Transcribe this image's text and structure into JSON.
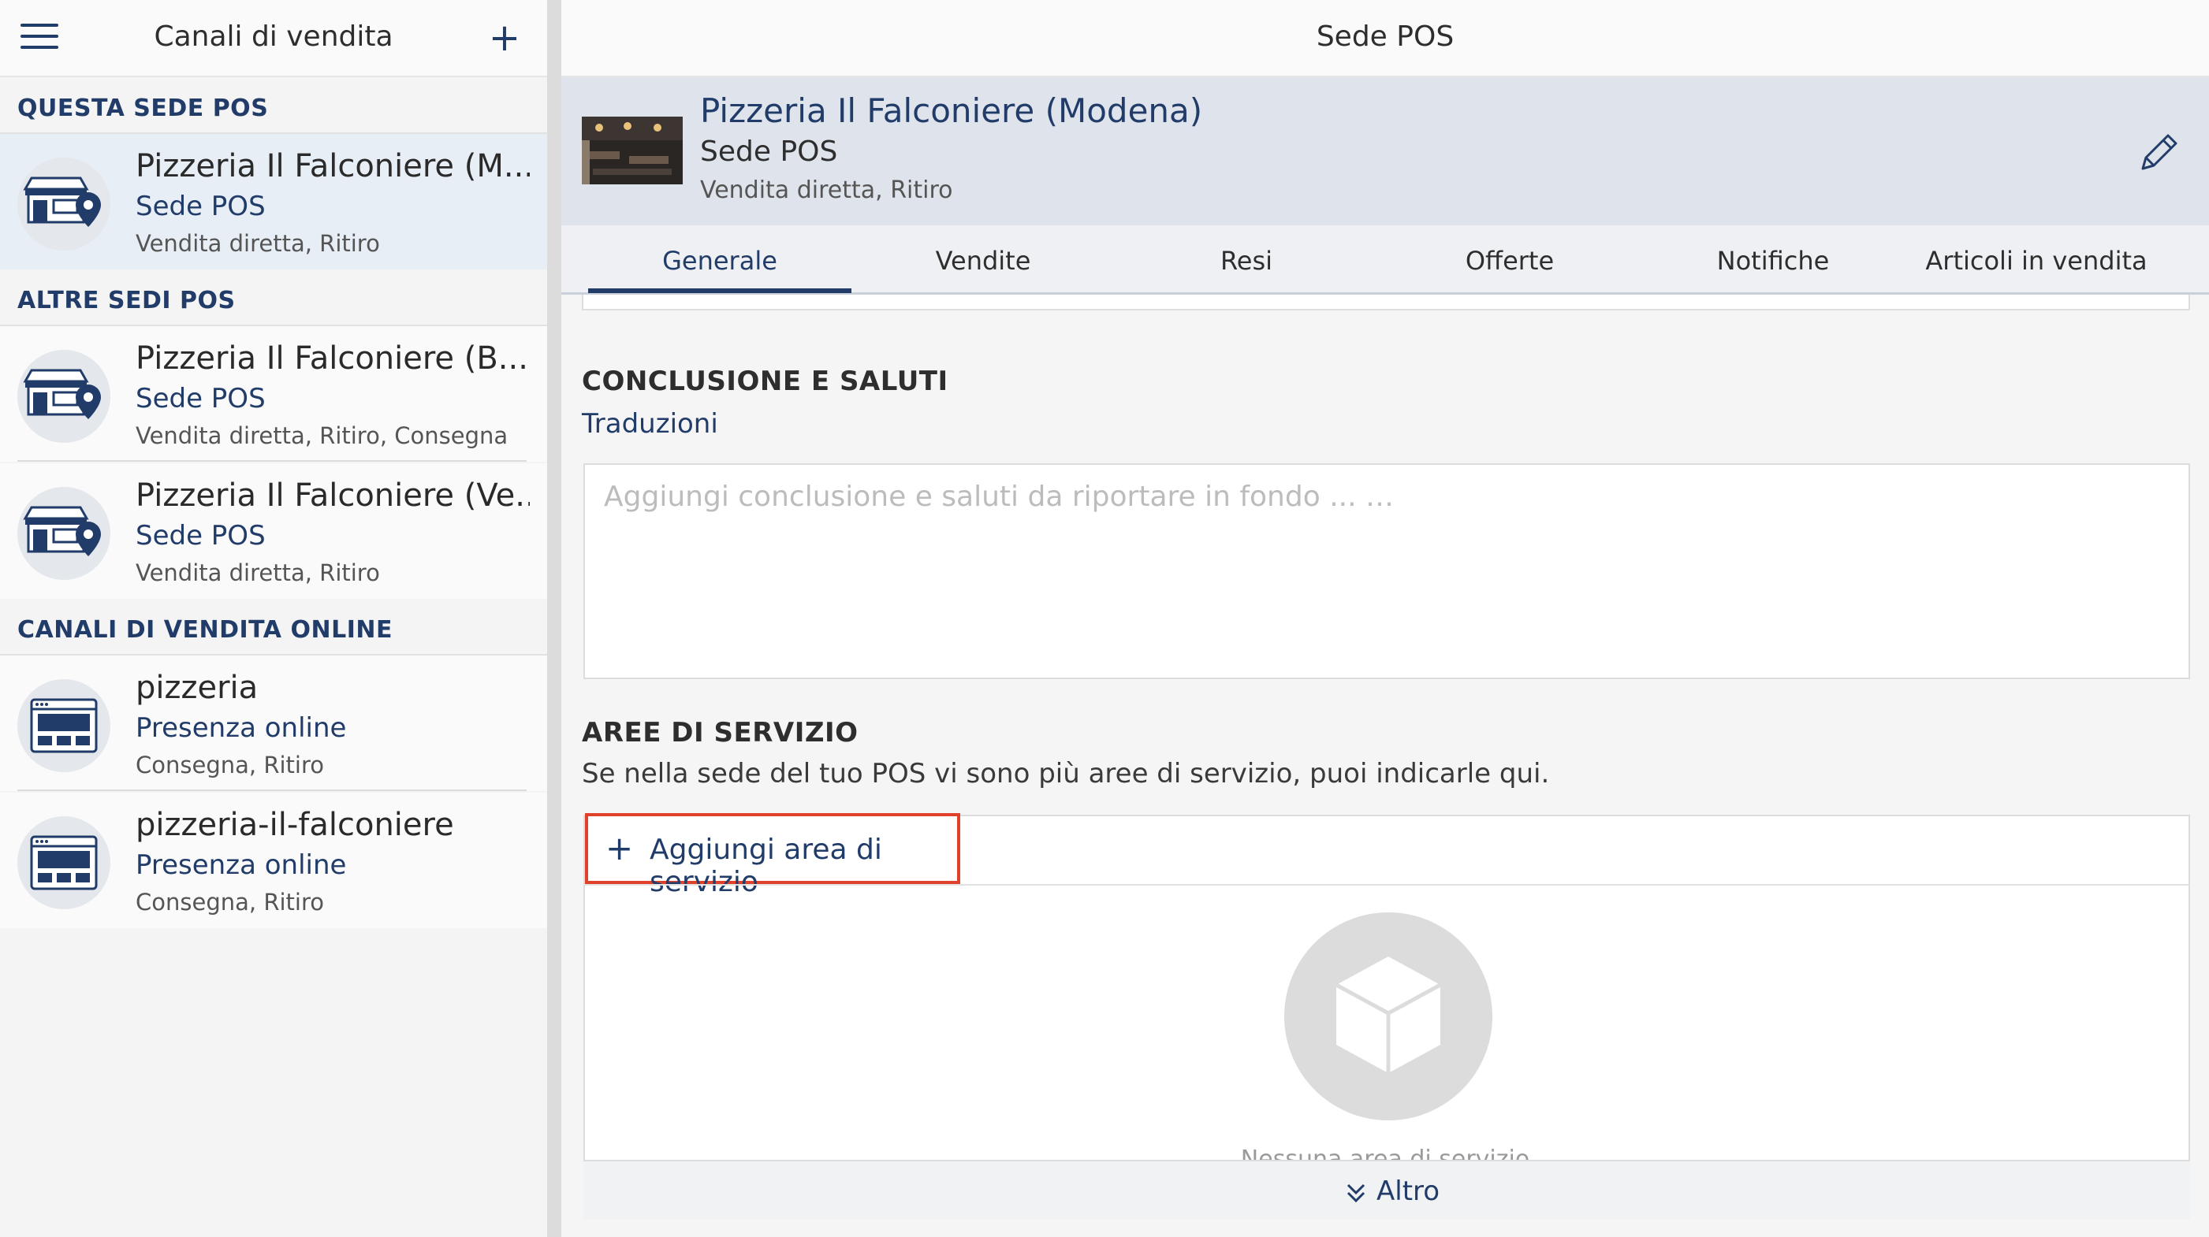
{
  "left": {
    "title": "Canali di vendita",
    "add_label": "+",
    "sections": [
      {
        "title": "QUESTA SEDE POS"
      },
      {
        "title": "ALTRE SEDI POS"
      },
      {
        "title": "CANALI DI VENDITA ONLINE"
      }
    ],
    "items": [
      {
        "name": "Pizzeria Il Falconiere (M...",
        "type": "Sede POS",
        "sub": "Vendita diretta, Ritiro",
        "icon": "store-location-icon"
      },
      {
        "name": "Pizzeria Il Falconiere (B...",
        "type": "Sede POS",
        "sub": "Vendita diretta, Ritiro, Consegna",
        "icon": "store-location-icon"
      },
      {
        "name": "Pizzeria Il Falconiere (Ve...",
        "type": "Sede POS",
        "sub": "Vendita diretta, Ritiro",
        "icon": "store-location-icon"
      },
      {
        "name": "pizzeria",
        "type": "Presenza online",
        "sub": "Consegna, Ritiro",
        "icon": "browser-window-icon"
      },
      {
        "name": "pizzeria-il-falconiere",
        "type": "Presenza online",
        "sub": "Consegna, Ritiro",
        "icon": "browser-window-icon"
      }
    ]
  },
  "right": {
    "title": "Sede POS",
    "info": {
      "name": "Pizzeria Il Falconiere (Modena)",
      "type": "Sede POS",
      "sub": "Vendita diretta, Ritiro"
    },
    "tabs": [
      {
        "label": "Generale"
      },
      {
        "label": "Vendite"
      },
      {
        "label": "Resi"
      },
      {
        "label": "Offerte"
      },
      {
        "label": "Notifiche"
      },
      {
        "label": "Articoli in vendita"
      }
    ],
    "closing": {
      "title": "CONCLUSIONE E SALUTI",
      "translations": "Traduzioni",
      "placeholder": "Aggiungi conclusione e saluti da riportare in fondo ... …"
    },
    "areas": {
      "title": "AREE DI SERVIZIO",
      "desc": "Se nella sede del tuo POS vi sono più aree di servizio, puoi indicarle qui.",
      "add_label": "Aggiungi area di servizio",
      "empty": "Nessuna area di servizio",
      "more": "Altro"
    }
  },
  "colors": {
    "accent": "#223c6a",
    "highlight": "#e0412b"
  }
}
